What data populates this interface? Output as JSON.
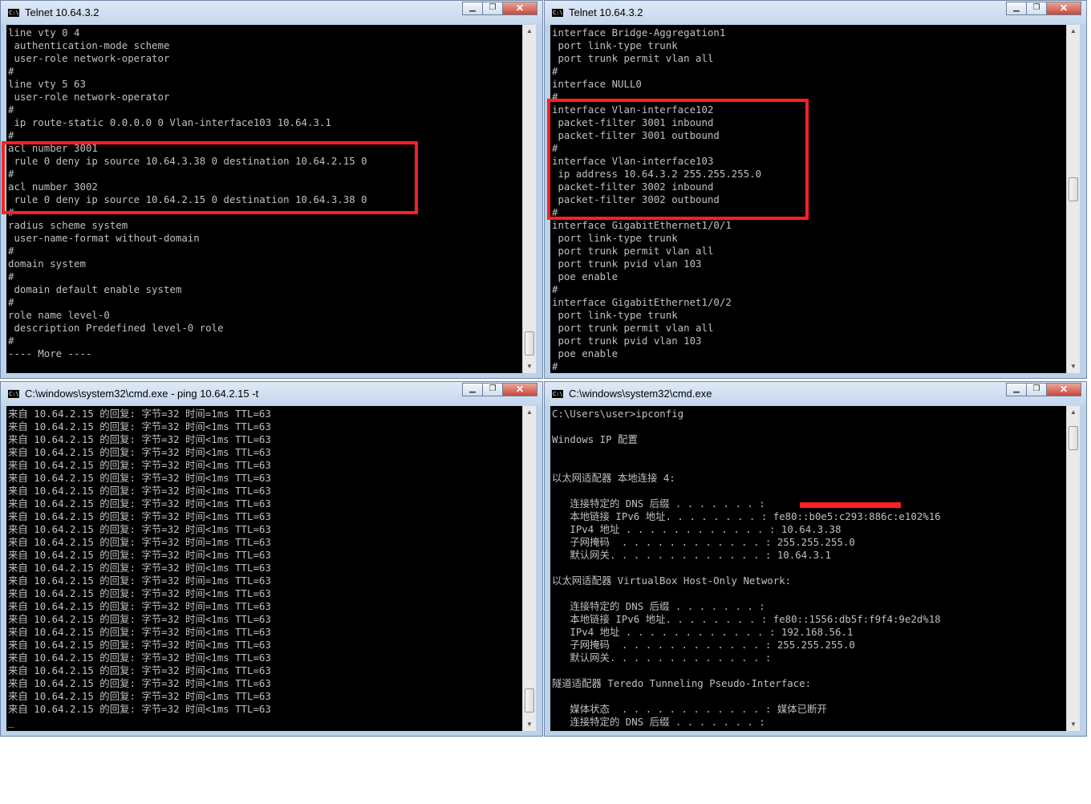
{
  "windows": {
    "tl": {
      "title": "Telnet 10.64.3.2",
      "lines": [
        "line vty 0 4",
        " authentication-mode scheme",
        " user-role network-operator",
        "#",
        "line vty 5 63",
        " user-role network-operator",
        "#",
        " ip route-static 0.0.0.0 0 Vlan-interface103 10.64.3.1",
        "#",
        "acl number 3001",
        " rule 0 deny ip source 10.64.3.38 0 destination 10.64.2.15 0",
        "#",
        "acl number 3002",
        " rule 0 deny ip source 10.64.2.15 0 destination 10.64.3.38 0",
        "#",
        "radius scheme system",
        " user-name-format without-domain",
        "#",
        "domain system",
        "#",
        " domain default enable system",
        "#",
        "role name level-0",
        " description Predefined level-0 role",
        "#",
        "---- More ----"
      ]
    },
    "tr": {
      "title": "Telnet 10.64.3.2",
      "lines": [
        "interface Bridge-Aggregation1",
        " port link-type trunk",
        " port trunk permit vlan all",
        "#",
        "interface NULL0",
        "#",
        "interface Vlan-interface102",
        " packet-filter 3001 inbound",
        " packet-filter 3001 outbound",
        "#",
        "interface Vlan-interface103",
        " ip address 10.64.3.2 255.255.255.0",
        " packet-filter 3002 inbound",
        " packet-filter 3002 outbound",
        "#",
        "interface GigabitEthernet1/0/1",
        " port link-type trunk",
        " port trunk permit vlan all",
        " port trunk pvid vlan 103",
        " poe enable",
        "#",
        "interface GigabitEthernet1/0/2",
        " port link-type trunk",
        " port trunk permit vlan all",
        " port trunk pvid vlan 103",
        " poe enable",
        "#"
      ]
    },
    "bl": {
      "title": "C:\\windows\\system32\\cmd.exe - ping  10.64.2.15 -t",
      "lines": [
        "来自 10.64.2.15 的回复: 字节=32 时间=1ms TTL=63",
        "来自 10.64.2.15 的回复: 字节=32 时间<1ms TTL=63",
        "来自 10.64.2.15 的回复: 字节=32 时间<1ms TTL=63",
        "来自 10.64.2.15 的回复: 字节=32 时间<1ms TTL=63",
        "来自 10.64.2.15 的回复: 字节=32 时间<1ms TTL=63",
        "来自 10.64.2.15 的回复: 字节=32 时间<1ms TTL=63",
        "来自 10.64.2.15 的回复: 字节=32 时间<1ms TTL=63",
        "来自 10.64.2.15 的回复: 字节=32 时间<1ms TTL=63",
        "来自 10.64.2.15 的回复: 字节=32 时间<1ms TTL=63",
        "来自 10.64.2.15 的回复: 字节=32 时间<1ms TTL=63",
        "来自 10.64.2.15 的回复: 字节=32 时间=1ms TTL=63",
        "来自 10.64.2.15 的回复: 字节=32 时间<1ms TTL=63",
        "来自 10.64.2.15 的回复: 字节=32 时间<1ms TTL=63",
        "来自 10.64.2.15 的回复: 字节=32 时间=1ms TTL=63",
        "来自 10.64.2.15 的回复: 字节=32 时间<1ms TTL=63",
        "来自 10.64.2.15 的回复: 字节=32 时间=1ms TTL=63",
        "来自 10.64.2.15 的回复: 字节=32 时间<1ms TTL=63",
        "来自 10.64.2.15 的回复: 字节=32 时间<1ms TTL=63",
        "来自 10.64.2.15 的回复: 字节=32 时间<1ms TTL=63",
        "来自 10.64.2.15 的回复: 字节=32 时间<1ms TTL=63",
        "来自 10.64.2.15 的回复: 字节=32 时间<1ms TTL=63",
        "来自 10.64.2.15 的回复: 字节=32 时间<1ms TTL=63",
        "来自 10.64.2.15 的回复: 字节=32 时间<1ms TTL=63",
        "来自 10.64.2.15 的回复: 字节=32 时间<1ms TTL=63",
        "_"
      ]
    },
    "br": {
      "title": "C:\\windows\\system32\\cmd.exe",
      "lines": [
        "C:\\Users\\user>ipconfig",
        "",
        "Windows IP 配置",
        "",
        "",
        "以太网适配器 本地连接 4:",
        "",
        "   连接特定的 DNS 后缀 . . . . . . . :",
        "   本地链接 IPv6 地址. . . . . . . . : fe80::b0e5:c293:886c:e102%16",
        "   IPv4 地址 . . . . . . . . . . . . : 10.64.3.38",
        "   子网掩码  . . . . . . . . . . . . : 255.255.255.0",
        "   默认网关. . . . . . . . . . . . . : 10.64.3.1",
        "",
        "以太网适配器 VirtualBox Host-Only Network:",
        "",
        "   连接特定的 DNS 后缀 . . . . . . . :",
        "   本地链接 IPv6 地址. . . . . . . . : fe80::1556:db5f:f9f4:9e2d%18",
        "   IPv4 地址 . . . . . . . . . . . . : 192.168.56.1",
        "   子网掩码  . . . . . . . . . . . . : 255.255.255.0",
        "   默认网关. . . . . . . . . . . . . :",
        "",
        "隧道适配器 Teredo Tunneling Pseudo-Interface:",
        "",
        "   媒体状态  . . . . . . . . . . . . : 媒体已断开",
        "   连接特定的 DNS 后缀 . . . . . . . :"
      ]
    }
  },
  "icons": {
    "app": "console-icon",
    "minimize": "minimize-icon",
    "maximize": "maximize-icon",
    "close": "close-icon"
  },
  "colors": {
    "highlight": "#ff2020",
    "console_bg": "#000000",
    "console_text": "#c0c0c0"
  }
}
